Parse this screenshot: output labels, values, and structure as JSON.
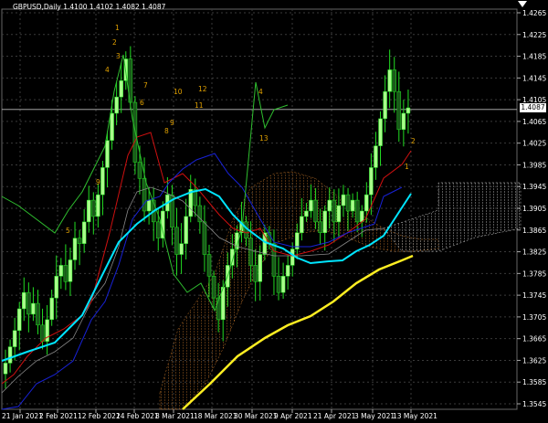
{
  "header": {
    "symbol_info": "GBPUSD,Daily  1.4100 1.4102 1.4082 1.4087"
  },
  "current_price": "1.4087",
  "colors": {
    "background": "#000000",
    "grid": "#3a3a3a",
    "bull_candle": "#a8ff8a",
    "bear_candle": "#1a5a1a",
    "wick": "#22dd22",
    "ma_fast": "#00e5ff",
    "ma_slow": "#ffee22",
    "line_red": "#d01010",
    "line_blue": "#1822d8",
    "line_green": "#2fbf2f",
    "cloud": "#c8782a",
    "cloud_future": "#d8d8d8",
    "annotations": "#e0a000"
  },
  "chart_data": {
    "type": "candlestick",
    "symbol": "GBPUSD",
    "timeframe": "Daily",
    "ylim": [
      1.3545,
      1.4265
    ],
    "y_ticks": [
      "1.4265",
      "1.4225",
      "1.4185",
      "1.4145",
      "1.4105",
      "1.4065",
      "1.4025",
      "1.3985",
      "1.3945",
      "1.3905",
      "1.3865",
      "1.3825",
      "1.3785",
      "1.3745",
      "1.3705",
      "1.3665",
      "1.3625",
      "1.3585",
      "1.3545"
    ],
    "x_ticks": [
      "21 Jan 2021",
      "2 Feb 2021",
      "12 Feb 2021",
      "24 Feb 2021",
      "8 Mar 2021",
      "18 Mar 2021",
      "30 Mar 2021",
      "9 Apr 2021",
      "21 Apr 2021",
      "3 May 2021",
      "13 May 2021"
    ],
    "annotations": [
      "1",
      "2",
      "3",
      "4",
      "4",
      "5",
      "6",
      "7",
      "8",
      "9",
      "9",
      "10",
      "11",
      "12",
      "13",
      "1",
      "2"
    ]
  }
}
